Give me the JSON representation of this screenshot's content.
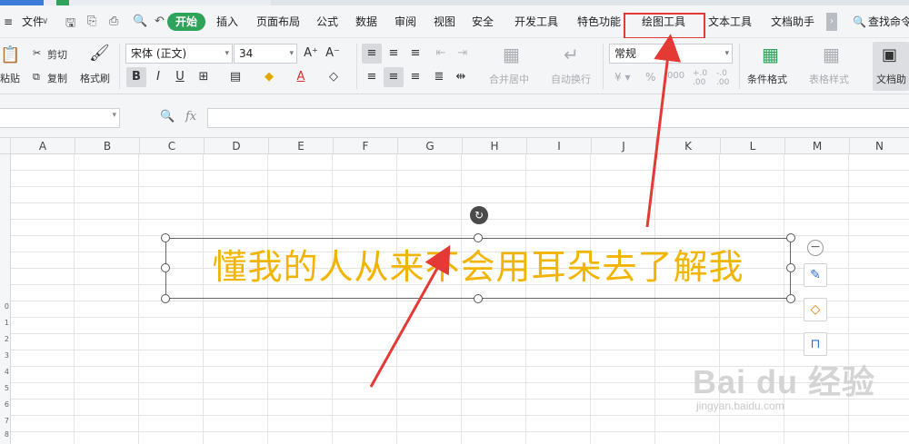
{
  "menu": {
    "file_label": "文件",
    "tabs": [
      "开始",
      "插入",
      "页面布局",
      "公式",
      "数据",
      "审阅",
      "视图",
      "安全",
      "开发工具",
      "特色功能",
      "绘图工具",
      "文本工具",
      "文档助手"
    ],
    "active_tab": "开始",
    "highlighted_tab": "绘图工具",
    "search_label": "查找命令"
  },
  "ribbon": {
    "cut_label": "剪切",
    "copy_label": "复制",
    "format_painter_label": "格式刷",
    "paste_label": "粘贴",
    "font_name": "宋体 (正文)",
    "font_size": "34",
    "merge_center_label": "合并居中",
    "wrap_text_label": "自动换行",
    "number_format": "常规",
    "conditional_format_label": "条件格式",
    "table_style_label": "表格样式",
    "doc_helper_label": "文档助"
  },
  "formula_bar": {
    "fx_label": "fx",
    "value": ""
  },
  "columns": [
    "A",
    "B",
    "C",
    "D",
    "E",
    "F",
    "G",
    "H",
    "I",
    "J",
    "K",
    "L",
    "M",
    "N"
  ],
  "rows": [
    "0",
    "1",
    "2",
    "3",
    "4",
    "5",
    "6",
    "7",
    "8"
  ],
  "shape": {
    "text": "懂我的人从来不会用耳朵去了解我",
    "text_color": "#f2b400"
  },
  "watermark": {
    "brand": "Bai du 经验",
    "url": "jingyan.baidu.com"
  },
  "colors": {
    "accent_green": "#2fa35a",
    "highlight_red": "#e53935"
  }
}
